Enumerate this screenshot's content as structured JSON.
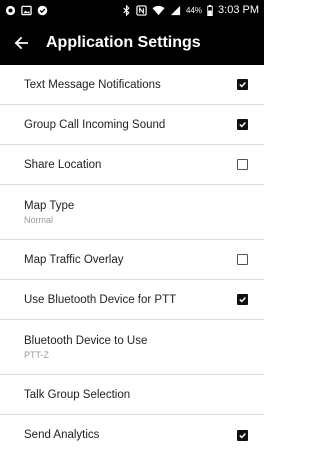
{
  "status_bar": {
    "battery": "44%",
    "time": "3:03 PM",
    "left_icons": [
      "whatsapp-icon",
      "image-icon",
      "check-circle-icon"
    ],
    "right_icons": [
      "bluetooth-icon",
      "nfc-icon",
      "wifi-icon",
      "signal-icon",
      "battery-icon"
    ]
  },
  "header": {
    "title": "Application Settings",
    "back_icon": "arrow-left-icon"
  },
  "settings": [
    {
      "label": "Text Message Notifications",
      "checked": true
    },
    {
      "label": "Group Call Incoming Sound",
      "checked": true
    },
    {
      "label": "Share Location",
      "checked": false
    },
    {
      "label": "Map Type",
      "value": "Normal"
    },
    {
      "label": "Map Traffic Overlay",
      "checked": false
    },
    {
      "label": "Use Bluetooth Device for PTT",
      "checked": true
    },
    {
      "label": "Bluetooth Device to Use",
      "value": "PTT-Z"
    },
    {
      "label": "Talk Group Selection"
    },
    {
      "label": "Send Analytics",
      "checked": true
    }
  ],
  "colors": {
    "app_bar": "#000000",
    "divider": "#dcdcdc",
    "checked": "#111111"
  }
}
